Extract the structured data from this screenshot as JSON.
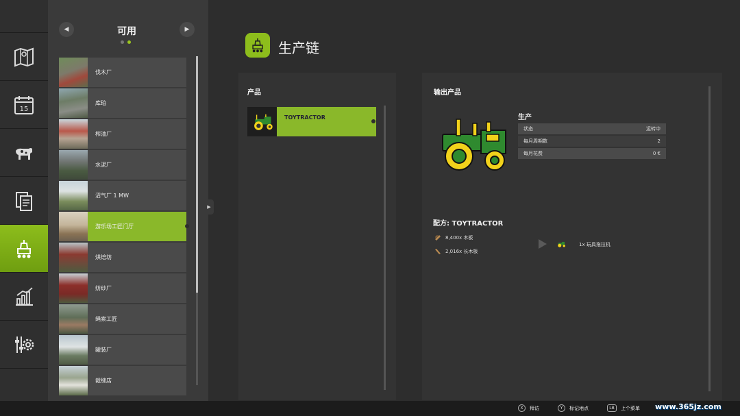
{
  "list": {
    "title": "可用",
    "items": [
      {
        "label": "伐木厂"
      },
      {
        "label": "库珀"
      },
      {
        "label": "榨油厂"
      },
      {
        "label": "水泥厂"
      },
      {
        "label": "沼气厂 1 MW"
      },
      {
        "label": "游乐场工匠门厅"
      },
      {
        "label": "烘焙坊"
      },
      {
        "label": "纺纱厂"
      },
      {
        "label": "绳索工匠"
      },
      {
        "label": "罐装厂"
      },
      {
        "label": "裁缝店"
      }
    ],
    "active_index": 5
  },
  "nav": {
    "items": [
      {
        "icon": "map-icon"
      },
      {
        "icon": "calendar-icon",
        "text": "15"
      },
      {
        "icon": "animals-icon"
      },
      {
        "icon": "contracts-icon"
      },
      {
        "icon": "production-icon",
        "active": true
      },
      {
        "icon": "statistics-icon"
      },
      {
        "icon": "settings-icon"
      }
    ]
  },
  "page": {
    "title": "生产链"
  },
  "products": {
    "label": "产品",
    "items": [
      {
        "label": "TOYTRACTOR"
      }
    ]
  },
  "output": {
    "label": "输出产品",
    "production_heading": "生产",
    "stats": [
      {
        "key": "状态",
        "value": "运转中"
      },
      {
        "key": "每月周期数",
        "value": "2"
      },
      {
        "key": "每月花费",
        "value": "0 €"
      }
    ],
    "recipe_title": "配方: TOYTRACTOR",
    "ingredients": [
      {
        "text": "8,400x 木板"
      },
      {
        "text": "2,016x 长木板"
      }
    ],
    "result": "1x 玩具拖拉机"
  },
  "bottom_hints": [
    {
      "key": "X",
      "label": "拜访"
    },
    {
      "key": "Y",
      "label": "标记地点"
    },
    {
      "key": "LB",
      "label": "上个菜单"
    }
  ],
  "watermark": "www.365jz.com",
  "colors": {
    "accent": "#8ab82a",
    "tractor_green": "#2f8a2f",
    "tractor_yellow": "#f2d21b"
  }
}
